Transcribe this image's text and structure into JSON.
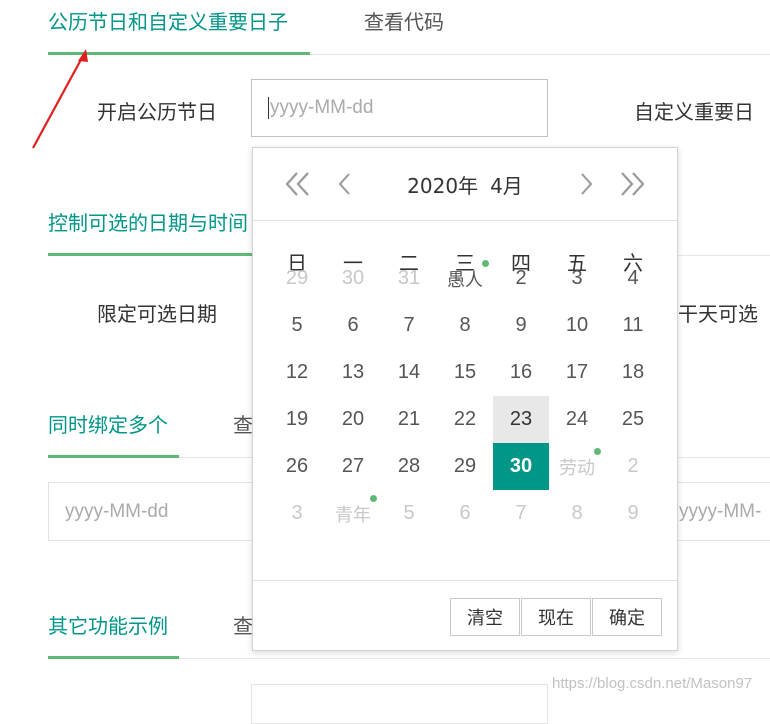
{
  "sections": {
    "holiday": {
      "tab_active": "公历节日和自定义重要日子",
      "tab_code": "查看代码",
      "label_holiday": "开启公历节日",
      "input_placeholder": "yyyy-MM-dd",
      "label_custom": "自定义重要日"
    },
    "range": {
      "tab_active": "控制可选的日期与时间",
      "label_limit": "限定可选日期",
      "label_right": "干天可选"
    },
    "multi": {
      "tab_active": "同时绑定多个",
      "tab_code": "查",
      "input_left_placeholder": "yyyy-MM-dd",
      "input_right_placeholder": "yyyy-MM-"
    },
    "other": {
      "tab_active": "其它功能示例",
      "tab_code": "查"
    }
  },
  "calendar": {
    "year": "2020年",
    "month": "4月",
    "weekdays": [
      "日",
      "一",
      "二",
      "三",
      "四",
      "五",
      "六"
    ],
    "weeks": [
      [
        {
          "t": "29",
          "o": true
        },
        {
          "t": "30",
          "o": true
        },
        {
          "t": "31",
          "o": true
        },
        {
          "t": "愚人",
          "o": false,
          "dot": true,
          "cn": true
        },
        {
          "t": "2"
        },
        {
          "t": "3"
        },
        {
          "t": "4"
        }
      ],
      [
        {
          "t": "5"
        },
        {
          "t": "6"
        },
        {
          "t": "7"
        },
        {
          "t": "8"
        },
        {
          "t": "9"
        },
        {
          "t": "10"
        },
        {
          "t": "11"
        }
      ],
      [
        {
          "t": "12"
        },
        {
          "t": "13"
        },
        {
          "t": "14"
        },
        {
          "t": "15"
        },
        {
          "t": "16"
        },
        {
          "t": "17"
        },
        {
          "t": "18"
        }
      ],
      [
        {
          "t": "19"
        },
        {
          "t": "20"
        },
        {
          "t": "21"
        },
        {
          "t": "22"
        },
        {
          "t": "23",
          "today": true
        },
        {
          "t": "24"
        },
        {
          "t": "25"
        }
      ],
      [
        {
          "t": "26"
        },
        {
          "t": "27"
        },
        {
          "t": "28"
        },
        {
          "t": "29"
        },
        {
          "t": "30",
          "selected": true
        },
        {
          "t": "劳动",
          "o": true,
          "dot": true,
          "cn": true
        },
        {
          "t": "2",
          "o": true
        }
      ],
      [
        {
          "t": "3",
          "o": true
        },
        {
          "t": "青年",
          "o": true,
          "dot": true,
          "cn": true
        },
        {
          "t": "5",
          "o": true
        },
        {
          "t": "6",
          "o": true
        },
        {
          "t": "7",
          "o": true
        },
        {
          "t": "8",
          "o": true
        },
        {
          "t": "9",
          "o": true
        }
      ]
    ],
    "buttons": {
      "clear": "清空",
      "now": "现在",
      "confirm": "确定"
    },
    "colors": {
      "accent": "#009688",
      "mark": "#5FB878",
      "today_bg": "#e8e8e8"
    }
  },
  "watermark": "https://blog.csdn.net/Mason97"
}
